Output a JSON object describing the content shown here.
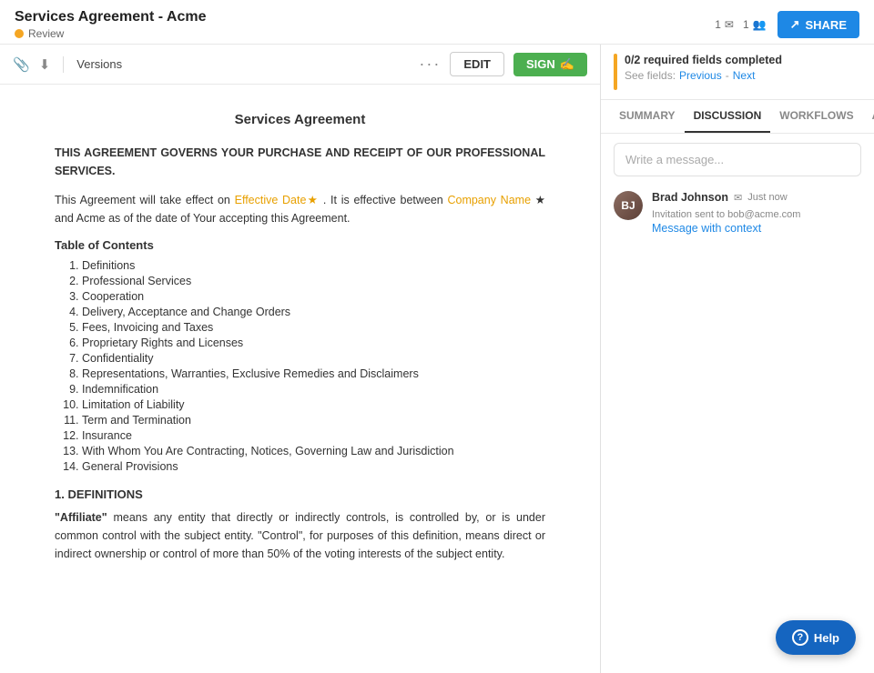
{
  "header": {
    "title": "Services Agreement - Acme",
    "review_label": "Review",
    "notifications": {
      "mail_count": "1",
      "people_count": "1"
    },
    "share_label": "SHARE"
  },
  "toolbar": {
    "versions_label": "Versions",
    "edit_label": "EDIT",
    "sign_label": "SIGN"
  },
  "fields_banner": {
    "title": "0/2 required fields completed",
    "see_fields": "See fields:",
    "previous_label": "Previous",
    "dash": "-",
    "next_label": "Next"
  },
  "tabs": {
    "summary": "SUMMARY",
    "discussion": "DISCUSSION",
    "workflows": "WORKFLOWS",
    "audit": "AUDIT",
    "active": "discussion"
  },
  "discussion": {
    "placeholder": "Write a message...",
    "messages": [
      {
        "name": "Brad Johnson",
        "email_icon": "✉",
        "time": "Just now",
        "sub_text": "Invitation sent to bob@acme.com",
        "context_label": "Message with context"
      }
    ]
  },
  "document": {
    "title": "Services Agreement",
    "intro_caps": "THIS AGREEMENT GOVERNS YOUR PURCHASE AND RECEIPT OF OUR PROFESSIONAL SERVICES.",
    "effective_text_before": "This Agreement will take effect on",
    "effective_date": "Effective Date★",
    "effective_text_mid": ". It is effective between",
    "company_name": "Company Name",
    "effective_text_after": "★ and Acme as of the date of Your accepting this Agreement.",
    "toc_title": "Table of Contents",
    "toc_items": [
      "Definitions",
      "Professional Services",
      "Cooperation",
      "Delivery, Acceptance and Change Orders",
      "Fees, Invoicing and Taxes",
      "Proprietary Rights and Licenses",
      "Confidentiality",
      "Representations, Warranties, Exclusive Remedies and Disclaimers",
      "Indemnification",
      "Limitation of Liability",
      "Term and Termination",
      "Insurance",
      "With Whom You Are Contracting, Notices, Governing Law and Jurisdiction",
      "General Provisions"
    ],
    "section1_heading": "1. DEFINITIONS",
    "section1_text": "\"Affiliate\" means any entity that directly or indirectly controls, is controlled by, or is under common control with the subject entity. \"Control\", for purposes of this definition, means direct or indirect ownership or control of more than 50% of the voting interests of the subject entity."
  },
  "help": {
    "label": "Help"
  }
}
